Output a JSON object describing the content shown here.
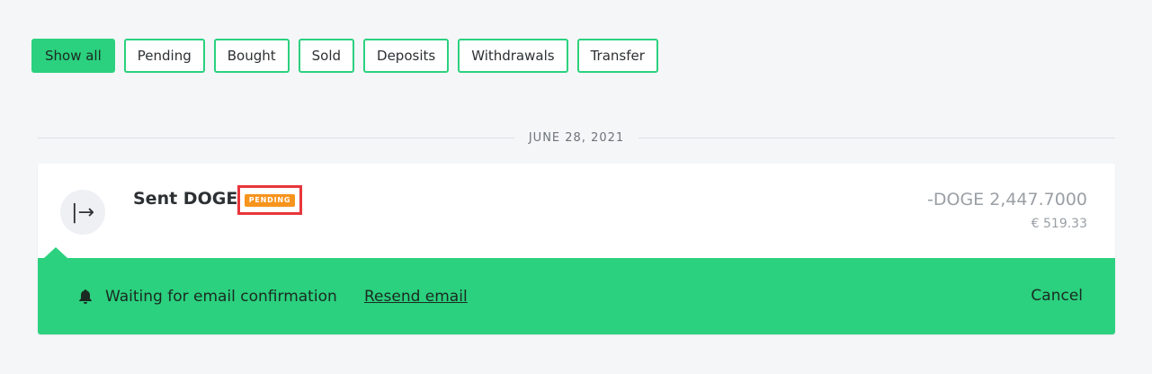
{
  "filters": [
    {
      "label": "Show all",
      "active": true
    },
    {
      "label": "Pending",
      "active": false
    },
    {
      "label": "Bought",
      "active": false
    },
    {
      "label": "Sold",
      "active": false
    },
    {
      "label": "Deposits",
      "active": false
    },
    {
      "label": "Withdrawals",
      "active": false
    },
    {
      "label": "Transfer",
      "active": false
    }
  ],
  "date_header": "JUNE 28, 2021",
  "transaction": {
    "icon": "send-arrow-icon",
    "icon_glyph": "|→",
    "title": "Sent DOGE",
    "status_badge": "PENDING",
    "amount": "-DOGE 2,447.7000",
    "fiat_amount": "€ 519.33"
  },
  "notice": {
    "icon": "bell-icon",
    "message": "Waiting for email confirmation",
    "resend_label": "Resend email",
    "cancel_label": "Cancel"
  },
  "colors": {
    "accent_green": "#2bd17e",
    "badge_orange": "#f7941d",
    "highlight_red": "#e8363b",
    "background": "#f5f6f8"
  }
}
